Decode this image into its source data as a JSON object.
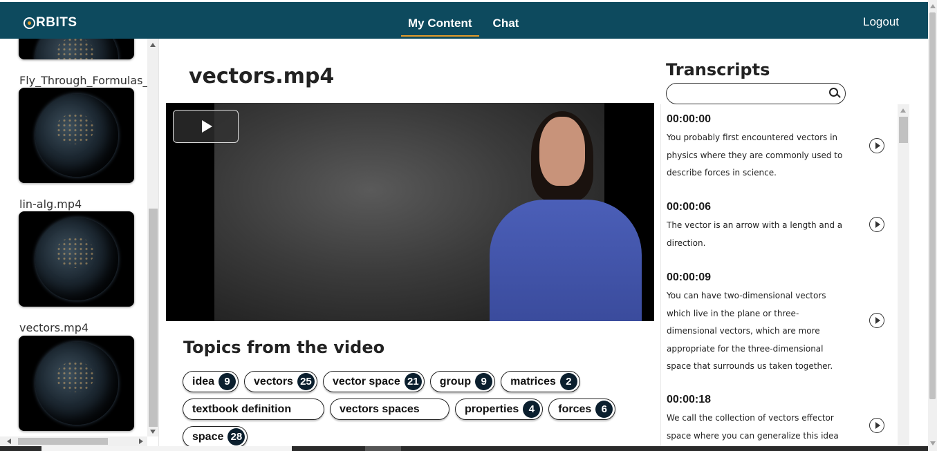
{
  "navbar": {
    "brand": "RBITS",
    "links": [
      {
        "label": "My Content",
        "active": true
      },
      {
        "label": "Chat",
        "active": false
      }
    ],
    "logout_label": "Logout",
    "bg_color": "#0d4a5e",
    "accent_color": "#e59c2b"
  },
  "sidebar": {
    "items": [
      {
        "label": ""
      },
      {
        "label": "Fly_Through_Formulas_Bl"
      },
      {
        "label": "lin-alg.mp4"
      },
      {
        "label": "vectors.mp4"
      }
    ]
  },
  "main": {
    "video_title": "vectors.mp4",
    "topics_heading": "Topics from the video",
    "topics": [
      {
        "label": "idea",
        "count": "9"
      },
      {
        "label": "vectors",
        "count": "25"
      },
      {
        "label": "vector space",
        "count": "21"
      },
      {
        "label": "group",
        "count": "9"
      },
      {
        "label": "matrices",
        "count": "2"
      },
      {
        "label": "textbook definition",
        "count": null
      },
      {
        "label": "vectors spaces",
        "count": null
      },
      {
        "label": "properties",
        "count": "4"
      },
      {
        "label": "forces",
        "count": "6"
      },
      {
        "label": "space",
        "count": "28"
      }
    ]
  },
  "transcripts": {
    "heading": "Transcripts",
    "search_value": "",
    "entries": [
      {
        "time": "00:00:00",
        "text": "You probably first encountered vectors in physics where they are commonly used to describe forces in science."
      },
      {
        "time": "00:00:06",
        "text": "The vector is an arrow with a length and a direction."
      },
      {
        "time": "00:00:09",
        "text": "You can have two-dimensional vectors which live in the plane or three-dimensional vectors, which are more appropriate for the three-dimensional space that surrounds us taken together."
      },
      {
        "time": "00:00:18",
        "text": "We call the collection of vectors effector space where you can generalize this idea and find"
      }
    ]
  }
}
